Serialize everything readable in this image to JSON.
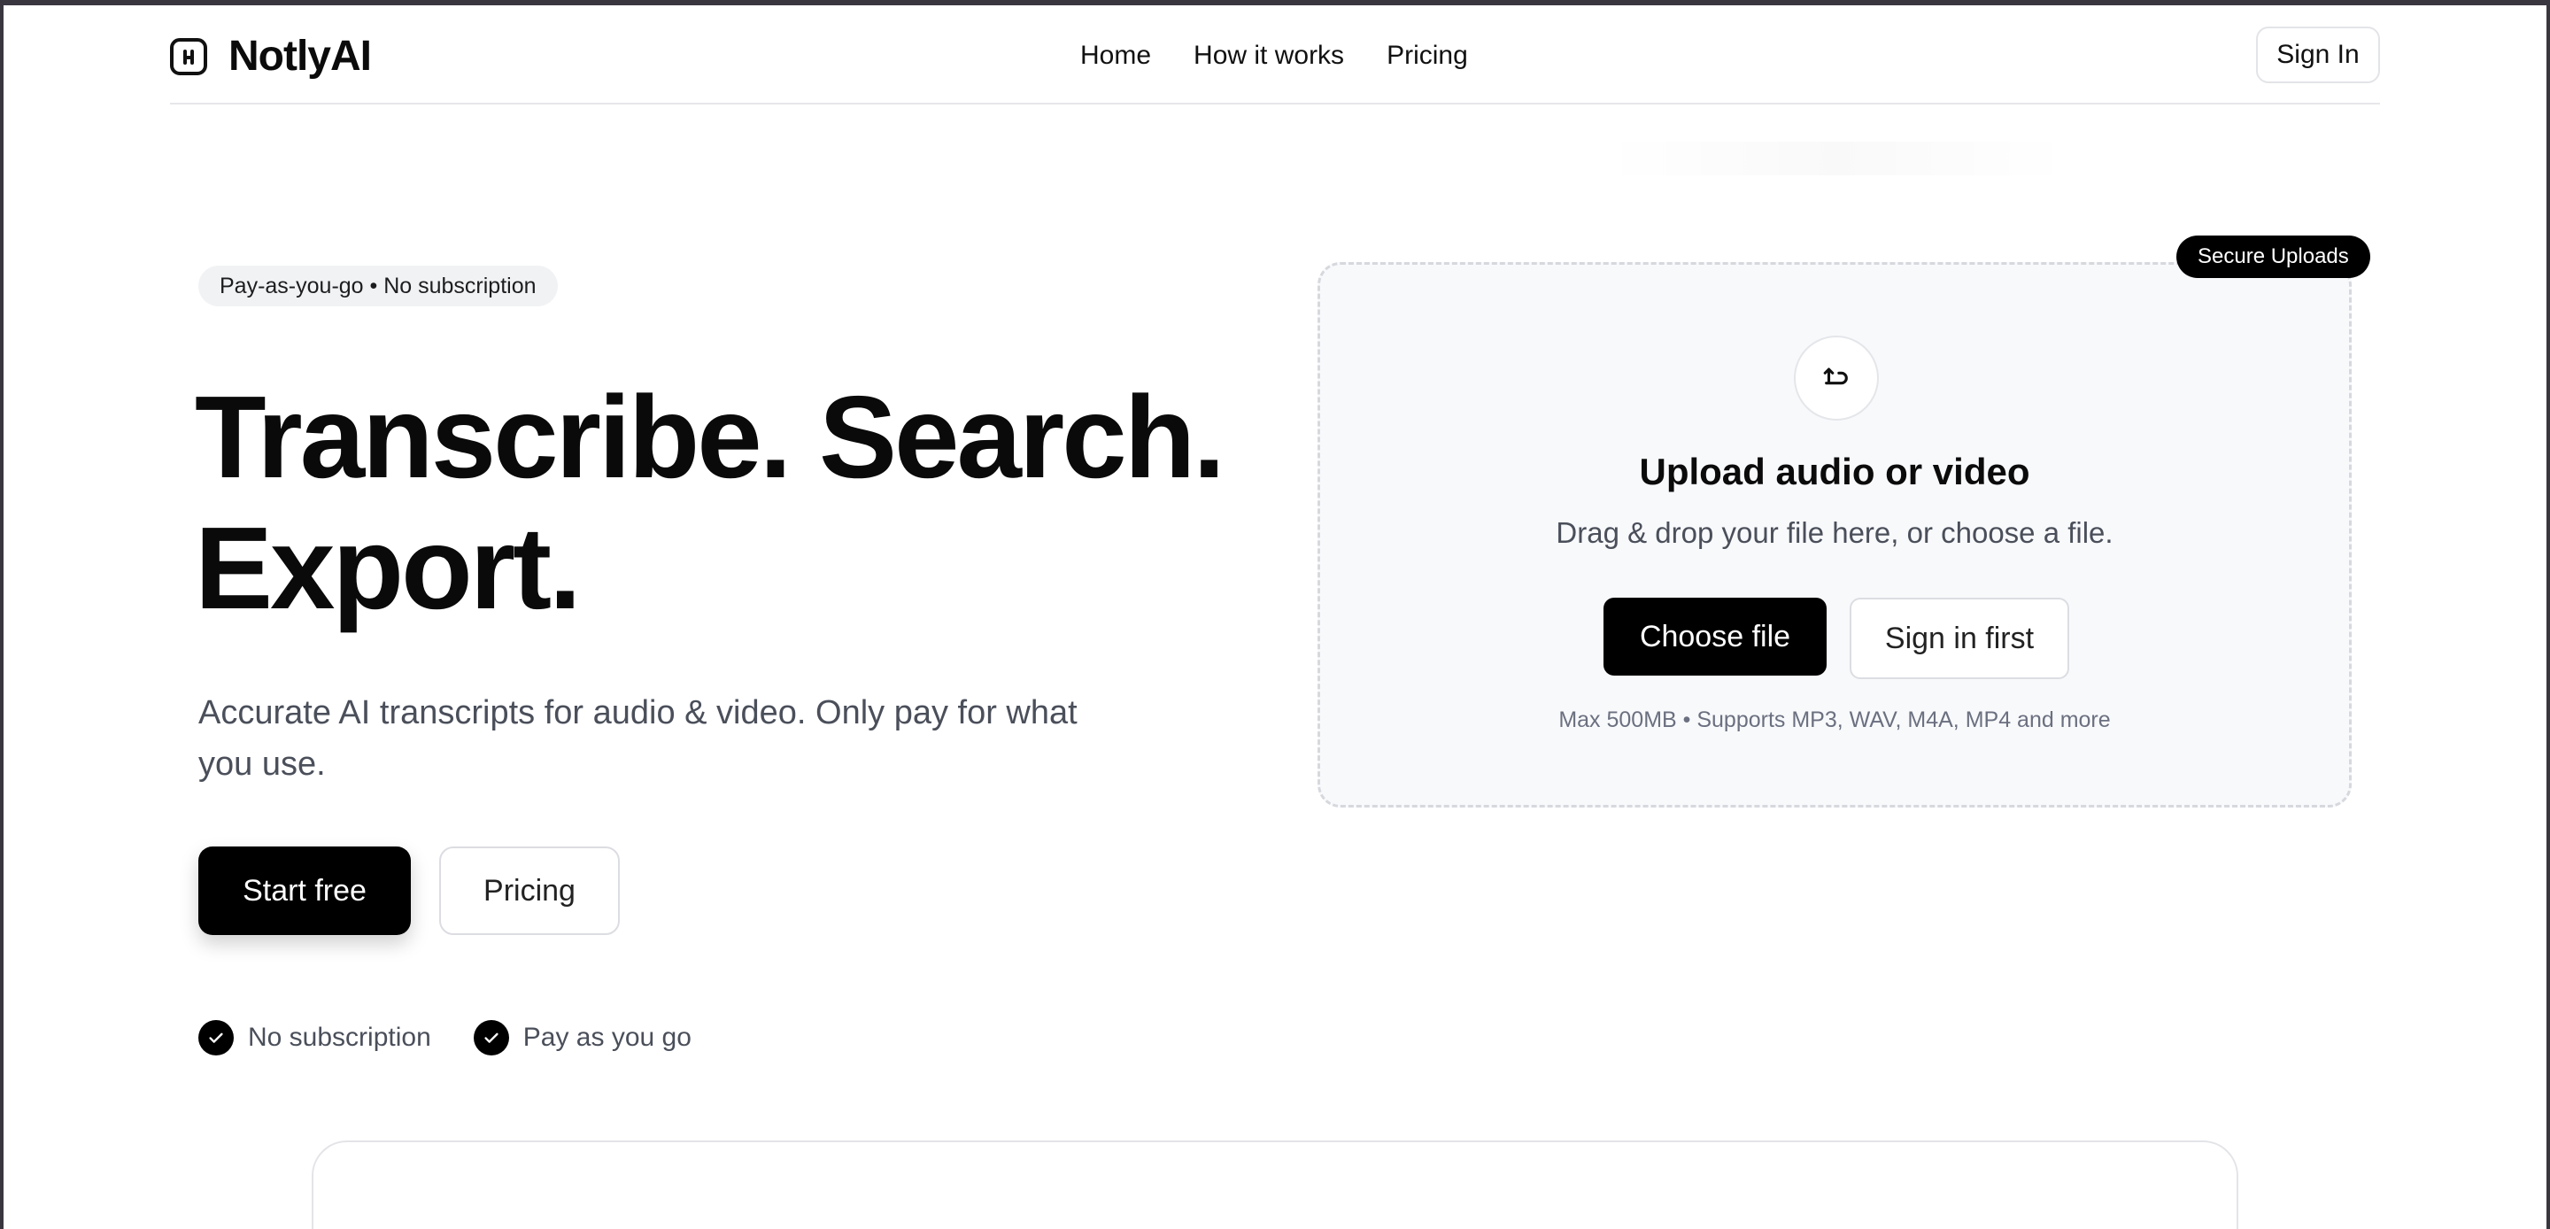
{
  "nav": {
    "brand": "NotlyAI",
    "links": [
      "Home",
      "How it works",
      "Pricing"
    ],
    "signin": "Sign In"
  },
  "hero": {
    "pill": "Pay-as-you-go • No subscription",
    "headline_line1": "Transcribe. Search.",
    "headline_line2": "Export.",
    "subhead": "Accurate AI transcripts for audio & video. Only pay for what you use.",
    "primary_cta": "Start free",
    "secondary_cta": "Pricing",
    "checks": [
      "No subscription",
      "Pay as you go"
    ]
  },
  "upload": {
    "badge": "Secure Uploads",
    "title": "Upload audio or video",
    "subtitle": "Drag & drop your file here, or choose a file.",
    "choose_button": "Choose file",
    "signin_button": "Sign in first",
    "note": "Max 500MB • Supports MP3, WAV, M4A, MP4 and more",
    "icon": "upload-icon"
  },
  "colors": {
    "accent": "#000000",
    "muted_text": "#4a4f5a",
    "card_bg": "#f8f9fb"
  }
}
